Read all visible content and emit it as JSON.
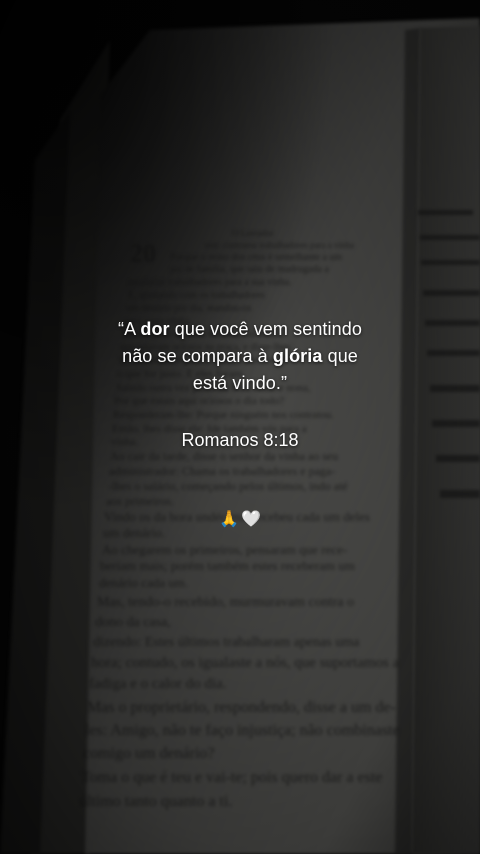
{
  "quote": {
    "open_mark": "“",
    "line1_pre": "A ",
    "line1_bold": "dor",
    "line1_post": " que você vem sentindo",
    "line2_pre": "não se compara à ",
    "line2_bold": "glória",
    "line2_post": " que",
    "line3": "está vindo.",
    "close_mark": "”"
  },
  "reference": "Romanos 8:18",
  "emojis": {
    "praying_hands": "🙏",
    "white_heart": "🤍"
  },
  "book": {
    "chapter_number": "20",
    "page_text_lines": [
      "O Lavrador",
      "entr. contratou trabalhadores para a vinha",
      "Porque o reino dos céus é semelhante a um",
      "pai de família, que saiu de madrugada a",
      "assalariar trabalhadores para a sua vinha.",
      "E, ajustando com os trabalhadores",
      "um denário por dia, mandou-os",
      "para a sua vinha.",
      "Saindo perto da hora terceira, viu outros",
      "que estavam ociosos na praça, e disse-lhes:",
      "Ide vós também para a vinha, e dar-vos-ei",
      "o que for justo. E eles foram.",
      "Saindo outra vez perto da hora sexta e nona,",
      "fez o mesmo. Saindo perto da hora undécima,",
      "encontrou outros e perguntou-lhes:",
      "Por que estais aqui ociosos o dia todo?",
      "Responderam-lhe: Porque ninguém nos contratou.",
      "Então, lhes disse ele: Ide também vós para a",
      "vinha.",
      "Ao cair da tarde, disse o senhor da vinha ao seu",
      "administrador: Chama os trabalhadores e paga-",
      "-lhes o salário, começando pelos últimos, indo até",
      "aos primeiros.",
      "Vindo os da hora undécima, recebeu cada um deles",
      "um denário.",
      "Ao chegarem os primeiros, pensaram que rece-",
      "beriam mais; porém também estes receberam um",
      "denário cada um.",
      "Mas, tendo-o recebido, murmuravam contra o",
      "dono da casa,",
      "dizendo: Estes últimos trabalharam apenas uma",
      "hora; contudo, os igualaste a nós, que suportamos a",
      "fadiga e o calor do dia.",
      "Mas o proprietário, respondendo, disse a um de-",
      "les: Amigo, não te faço injustiça; não combinaste",
      "comigo um denário?",
      "Toma o que é teu e vai-te; pois quero dar a este",
      "último tanto quanto a ti."
    ]
  }
}
